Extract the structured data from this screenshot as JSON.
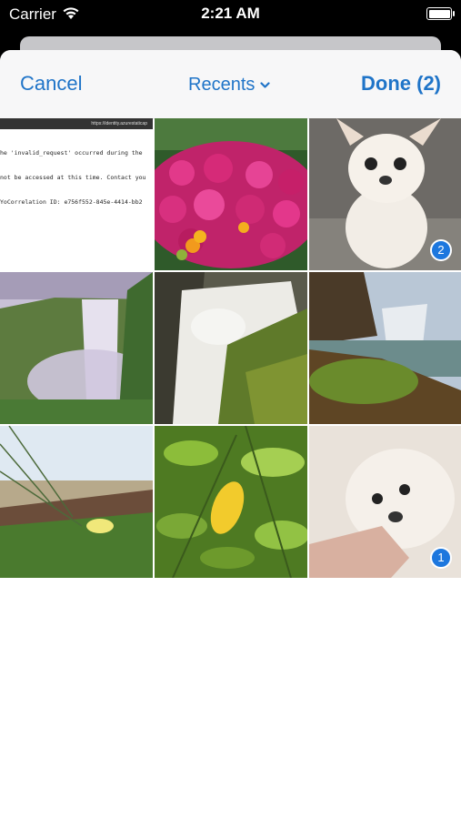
{
  "status_bar": {
    "carrier": "Carrier",
    "time": "2:21 AM"
  },
  "nav": {
    "cancel_label": "Cancel",
    "album_label": "Recents",
    "done_label": "Done (2)"
  },
  "grid": {
    "screenshot_url": "https://identity.azurestaticap",
    "screenshot_lines": [
      "he 'invalid_request' occurred during the",
      "not be accessed at this time. Contact you",
      "YoCorrelation ID: e756f552-845e-4414-bb2"
    ],
    "badges": [
      "2",
      "1"
    ]
  },
  "colors": {
    "accent": "#1f74c8",
    "badge": "#1d77de"
  }
}
